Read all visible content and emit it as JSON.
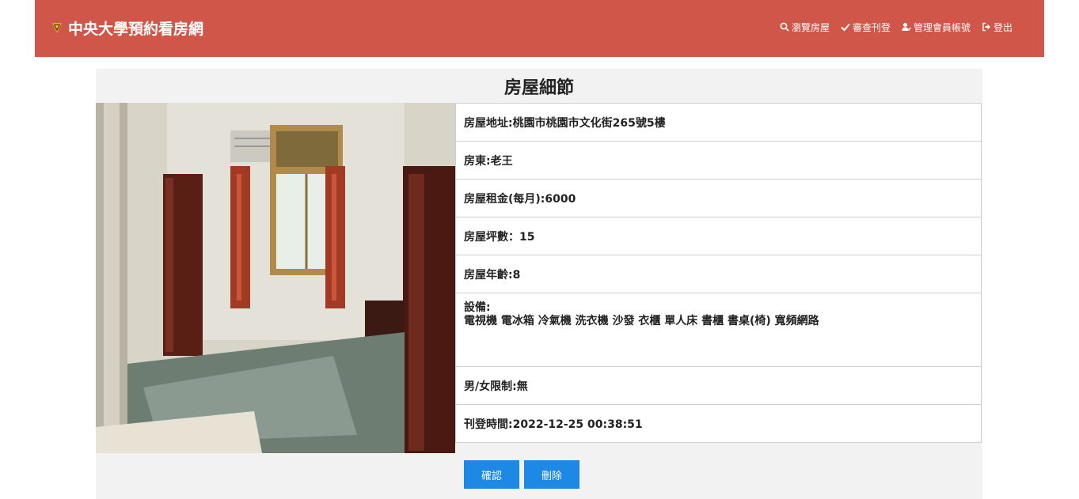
{
  "header": {
    "brand": "中央大學預約看房網",
    "nav": [
      {
        "icon": "search-icon",
        "label": "瀏覽房屋"
      },
      {
        "icon": "check-icon",
        "label": "審查刊登"
      },
      {
        "icon": "user-check-icon",
        "label": "管理會員帳號"
      },
      {
        "icon": "sign-out-icon",
        "label": "登出"
      }
    ]
  },
  "page": {
    "title": "房屋細節",
    "photo_icon": "room-photo",
    "details": {
      "address": "房屋地址:桃園市桃園市文化街265號5樓",
      "landlord": "房東:老王",
      "rent": "房屋租金(每月):6000",
      "size": "房屋坪數：15",
      "age": "房屋年齡:8",
      "equipment_label": "設備:",
      "equipment_value": "電視機 電冰箱 冷氣機 洗衣機 沙發 衣櫃 單人床 書櫃 書桌(椅) 寬頻網路",
      "gender": "男/女限制:無",
      "posted": "刊登時間:2022-12-25 00:38:51"
    },
    "buttons": {
      "confirm": "確認",
      "delete": "刪除"
    }
  },
  "colors": {
    "navbar": "#d0564a",
    "button": "#1e88e5",
    "panel": "#f2f2f2"
  }
}
